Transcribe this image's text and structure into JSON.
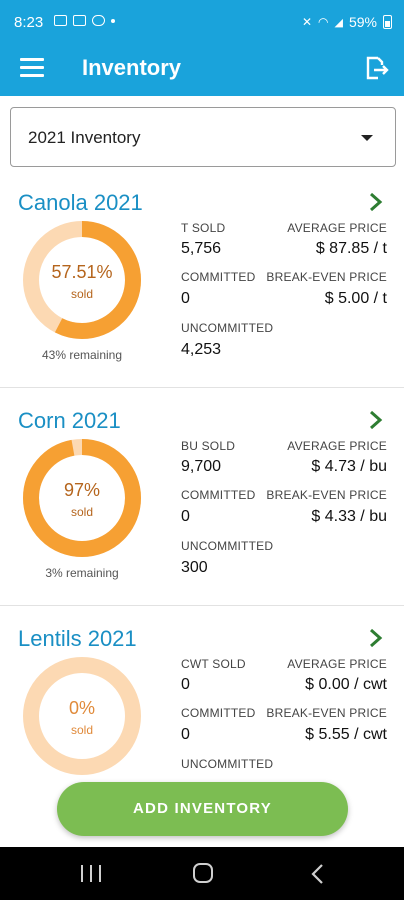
{
  "status_bar": {
    "time": "8:23",
    "battery": "59%"
  },
  "app_bar": {
    "title": "Inventory"
  },
  "dropdown": {
    "value": "2021 Inventory"
  },
  "crops": [
    {
      "title": "Canola 2021",
      "percent_label": "57.51%",
      "percent_value": 57.51,
      "sold_label": "sold",
      "remaining": "43% remaining",
      "sold_header": "T SOLD",
      "sold_value": "5,756",
      "committed_header": "COMMITTED",
      "committed_value": "0",
      "uncommitted_header": "UNCOMMITTED",
      "uncommitted_value": "4,253",
      "avg_header": "AVERAGE PRICE",
      "avg_value": "$ 87.85 / t",
      "be_header": "BREAK-EVEN PRICE",
      "be_value": "$ 5.00 / t"
    },
    {
      "title": "Corn 2021",
      "percent_label": "97%",
      "percent_value": 97,
      "sold_label": "sold",
      "remaining": "3% remaining",
      "sold_header": "BU SOLD",
      "sold_value": "9,700",
      "committed_header": "COMMITTED",
      "committed_value": "0",
      "uncommitted_header": "UNCOMMITTED",
      "uncommitted_value": "300",
      "avg_header": "AVERAGE PRICE",
      "avg_value": "$ 4.73 / bu",
      "be_header": "BREAK-EVEN PRICE",
      "be_value": "$ 4.33 / bu"
    },
    {
      "title": "Lentils 2021",
      "percent_label": "0%",
      "percent_value": 0,
      "sold_label": "sold",
      "sold_header": "CWT SOLD",
      "sold_value": "0",
      "committed_header": "COMMITTED",
      "committed_value": "0",
      "uncommitted_header": "UNCOMMITTED",
      "avg_header": "AVERAGE PRICE",
      "avg_value": "$ 0.00 / cwt",
      "be_header": "BREAK-EVEN PRICE",
      "be_value": "$ 5.55 / cwt"
    }
  ],
  "add_button": {
    "label": "ADD INVENTORY"
  },
  "colors": {
    "primary": "#1aa3db",
    "ring_fill": "#f6a033",
    "ring_track": "#fcd9b3",
    "chevron": "#2e7d32",
    "add_button": "#7cbd52"
  }
}
